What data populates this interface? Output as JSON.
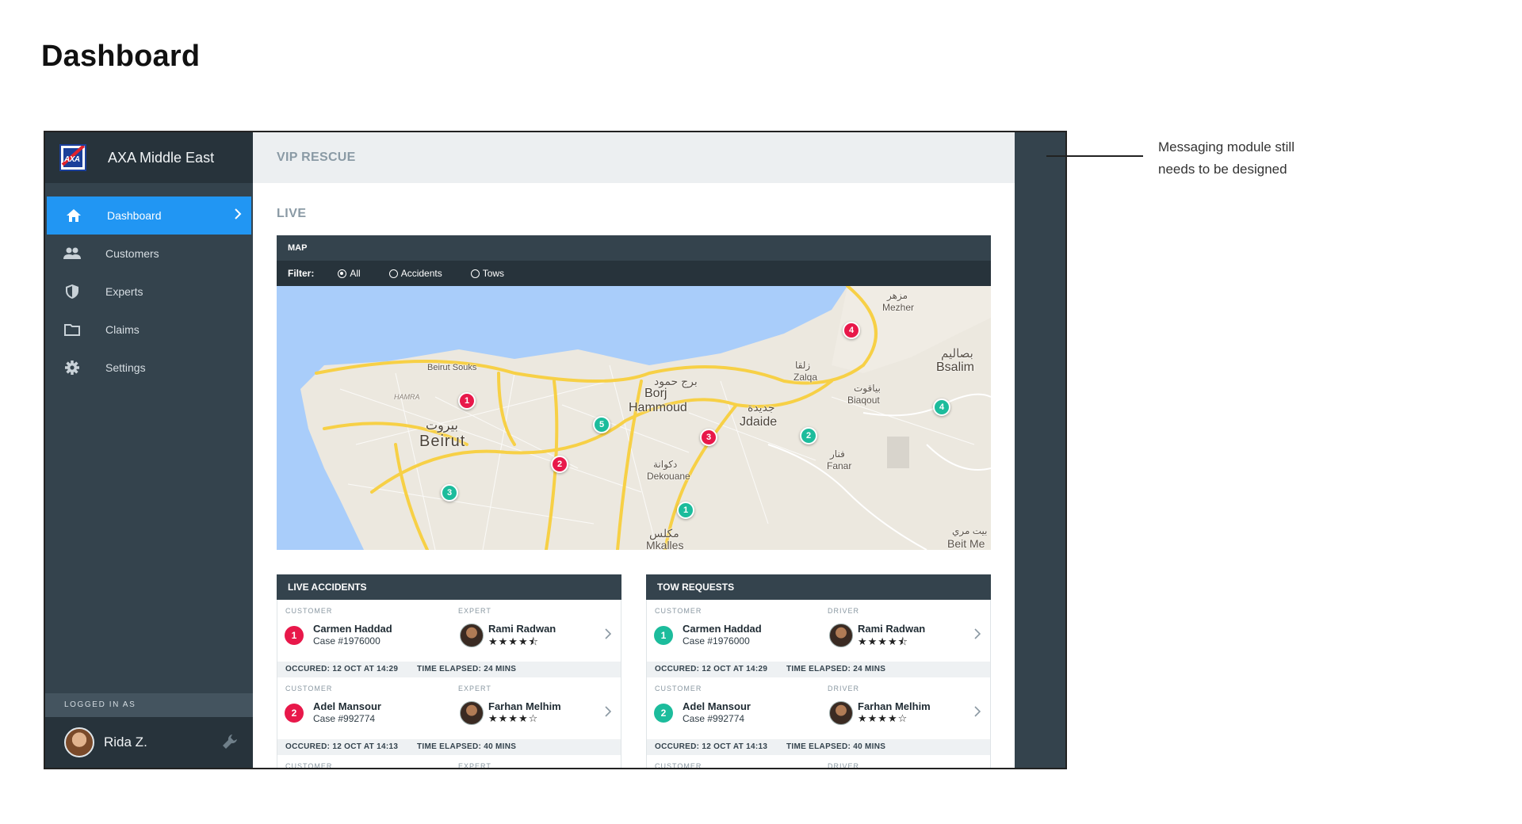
{
  "page_title": "Dashboard",
  "annotation": {
    "line1": "Messaging module still",
    "line2": "needs to be designed"
  },
  "sidebar": {
    "brand": "AXA Middle East",
    "items": [
      {
        "label": "Dashboard",
        "icon": "home-icon",
        "active": true
      },
      {
        "label": "Customers",
        "icon": "people-icon"
      },
      {
        "label": "Experts",
        "icon": "shield-icon"
      },
      {
        "label": "Claims",
        "icon": "folder-icon"
      },
      {
        "label": "Settings",
        "icon": "gear-icon"
      }
    ],
    "logged_in_label": "LOGGED IN AS",
    "user_name": "Rida Z."
  },
  "topbar": {
    "title": "VIP RESCUE"
  },
  "section": {
    "title": "LIVE"
  },
  "map": {
    "title": "MAP",
    "filter_label": "Filter:",
    "filters": [
      {
        "label": "All",
        "selected": true
      },
      {
        "label": "Accidents",
        "selected": false
      },
      {
        "label": "Tows",
        "selected": false
      }
    ],
    "labels": {
      "beirut": "Beirut",
      "beirut_ar": "بيروت",
      "borj": "Borj",
      "hammoud": "Hammoud",
      "borj_ar": "برج حمود",
      "jdaide": "Jdaide",
      "jdaide_ar": "جديدة",
      "zalqa": "Zalqa",
      "zalqa_ar": "زلقا",
      "bsalim": "Bsalim",
      "bsalim_ar": "بصاليم",
      "biaqout": "Biaqout",
      "biaqout_ar": "بياقوت",
      "mezher": "Mezher",
      "mezher_ar": "مزهر",
      "fanar": "Fanar",
      "fanar_ar": "فنار",
      "dekouane": "Dekouane",
      "dekouane_ar": "دكوانة",
      "mkalles": "Mkalles",
      "mkalles_ar": "مكلس",
      "beitme": "Beit Me",
      "beitme_ar": "بيت مري",
      "souks": "Beirut Souks",
      "hamra": "HAMRA"
    },
    "pins": [
      {
        "n": "1",
        "kind": "red"
      },
      {
        "n": "2",
        "kind": "red"
      },
      {
        "n": "3",
        "kind": "red"
      },
      {
        "n": "4",
        "kind": "red"
      },
      {
        "n": "1",
        "kind": "green"
      },
      {
        "n": "2",
        "kind": "green"
      },
      {
        "n": "3",
        "kind": "green"
      },
      {
        "n": "4",
        "kind": "green"
      },
      {
        "n": "5",
        "kind": "green"
      }
    ]
  },
  "accidents": {
    "title": "LIVE ACCIDENTS",
    "customer_label": "CUSTOMER",
    "person_label": "EXPERT",
    "rows": [
      {
        "n": "1",
        "customer": "Carmen Haddad",
        "case": "Case #1976000",
        "person": "Rami Radwan",
        "stars": "★★★★⯪",
        "occured": "OCCURED: 12 OCT AT 14:29",
        "elapsed": "TIME ELAPSED: 24 MINS"
      },
      {
        "n": "2",
        "customer": "Adel Mansour",
        "case": "Case #992774",
        "person": "Farhan Melhim",
        "stars": "★★★★☆",
        "occured": "OCCURED: 12 OCT AT 14:13",
        "elapsed": "TIME ELAPSED: 40 MINS"
      }
    ]
  },
  "tows": {
    "title": "TOW REQUESTS",
    "customer_label": "CUSTOMER",
    "person_label": "DRIVER",
    "rows": [
      {
        "n": "1",
        "customer": "Carmen Haddad",
        "case": "Case #1976000",
        "person": "Rami Radwan",
        "stars": "★★★★⯪",
        "occured": "OCCURED: 12 OCT AT 14:29",
        "elapsed": "TIME ELAPSED: 24 MINS"
      },
      {
        "n": "2",
        "customer": "Adel Mansour",
        "case": "Case #992774",
        "person": "Farhan Melhim",
        "stars": "★★★★☆",
        "occured": "OCCURED: 12 OCT AT 14:13",
        "elapsed": "TIME ELAPSED: 40 MINS"
      }
    ]
  },
  "colors": {
    "accent": "#2196f3",
    "sidebar": "#34434d",
    "red": "#e8184a",
    "green": "#1cbc9c"
  }
}
